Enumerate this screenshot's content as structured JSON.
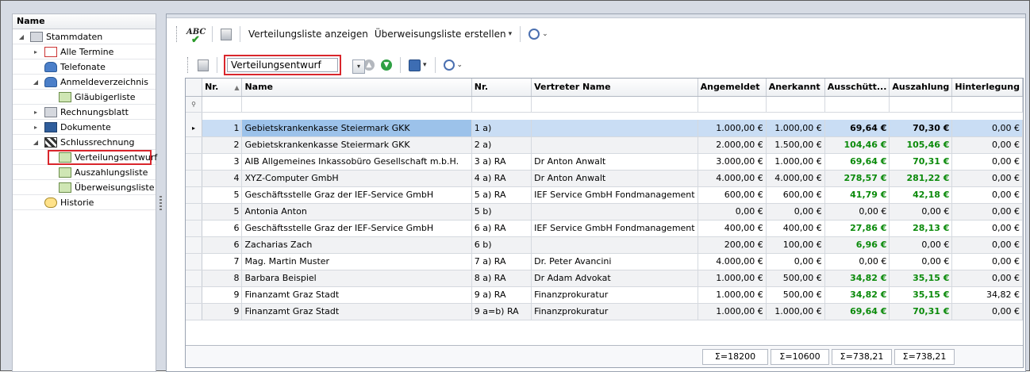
{
  "tree": {
    "header": "Name",
    "items": [
      {
        "label": "Stammdaten",
        "level": 0,
        "expander": "◢",
        "icon": "building-icon"
      },
      {
        "label": "Alle Termine",
        "level": 1,
        "expander": "▸",
        "icon": "calendar-icon"
      },
      {
        "label": "Telefonate",
        "level": 1,
        "expander": "",
        "icon": "phone-contacts-icon"
      },
      {
        "label": "Anmeldeverzeichnis",
        "level": 1,
        "expander": "◢",
        "icon": "users-icon"
      },
      {
        "label": "Gläubigerliste",
        "level": 2,
        "expander": "",
        "icon": "money-icon"
      },
      {
        "label": "Rechnungsblatt",
        "level": 1,
        "expander": "▸",
        "icon": "calculator-icon"
      },
      {
        "label": "Dokumente",
        "level": 1,
        "expander": "▸",
        "icon": "documents-icon"
      },
      {
        "label": "Schlussrechnung",
        "level": 1,
        "expander": "◢",
        "icon": "checkered-flag-icon"
      },
      {
        "label": "Verteilungsentwurf",
        "level": 2,
        "expander": "",
        "icon": "banknote-icon",
        "selected": true
      },
      {
        "label": "Auszahlungsliste",
        "level": 2,
        "expander": "",
        "icon": "banknote-icon"
      },
      {
        "label": "Überweisungsliste",
        "level": 2,
        "expander": "",
        "icon": "banknote-icon"
      },
      {
        "label": "Historie",
        "level": 1,
        "expander": "",
        "icon": "history-icon"
      }
    ]
  },
  "toolbar1": {
    "spellcheck_label": "ABC",
    "show_list_label": "Verteilungsliste anzeigen",
    "create_transfer_label": "Überweisungsliste erstellen",
    "dropdown_glyph": "▾",
    "chevron_glyph": "⌄"
  },
  "toolbar2": {
    "combo_value": "Verteilungsentwurf",
    "combo_arrow": "▾"
  },
  "grid": {
    "columns": [
      "Nr.",
      "Name",
      "Nr.",
      "Vertreter Name",
      "Angemeldet",
      "Anerkannt",
      "Ausschütt...",
      "Auszahlung",
      "Hinterlegung"
    ],
    "filter_glyph": "⚲",
    "row_indicator": "▸",
    "sort_glyph": "▲",
    "rows": [
      {
        "nr": "1",
        "name": "Gebietskrankenkasse Steiermark GKK",
        "nr2": "1 a)",
        "vertreter": "",
        "angemeldet": "1.000,00 €",
        "anerkannt": "1.000,00 €",
        "ausschuett": "69,64 €",
        "auszahlung": "70,30 €",
        "hinterlegung": "0,00 €"
      },
      {
        "nr": "2",
        "name": "Gebietskrankenkasse Steiermark GKK",
        "nr2": "2 a)",
        "vertreter": "",
        "angemeldet": "2.000,00 €",
        "anerkannt": "1.500,00 €",
        "ausschuett": "104,46 €",
        "auszahlung": "105,46 €",
        "hinterlegung": "0,00 €"
      },
      {
        "nr": "3",
        "name": "AIB Allgemeines Inkassobüro Gesellschaft m.b.H.",
        "nr2": "3 a) RA",
        "vertreter": "Dr Anton Anwalt",
        "angemeldet": "3.000,00 €",
        "anerkannt": "1.000,00 €",
        "ausschuett": "69,64 €",
        "auszahlung": "70,31 €",
        "hinterlegung": "0,00 €"
      },
      {
        "nr": "4",
        "name": "XYZ-Computer GmbH",
        "nr2": "4 a) RA",
        "vertreter": "Dr Anton Anwalt",
        "angemeldet": "4.000,00 €",
        "anerkannt": "4.000,00 €",
        "ausschuett": "278,57 €",
        "auszahlung": "281,22 €",
        "hinterlegung": "0,00 €"
      },
      {
        "nr": "5",
        "name": "Geschäftsstelle Graz der IEF-Service GmbH",
        "nr2": "5 a) RA",
        "vertreter": "IEF Service GmbH Fondmanagement",
        "angemeldet": "600,00 €",
        "anerkannt": "600,00 €",
        "ausschuett": "41,79 €",
        "auszahlung": "42,18 €",
        "hinterlegung": "0,00 €"
      },
      {
        "nr": "5",
        "name": "Antonia Anton",
        "nr2": "5 b)",
        "vertreter": "",
        "angemeldet": "0,00 €",
        "anerkannt": "0,00 €",
        "ausschuett": "0,00 €",
        "auszahlung": "0,00 €",
        "hinterlegung": "0,00 €"
      },
      {
        "nr": "6",
        "name": "Geschäftsstelle Graz der IEF-Service GmbH",
        "nr2": "6 a) RA",
        "vertreter": "IEF Service GmbH Fondmanagement",
        "angemeldet": "400,00 €",
        "anerkannt": "400,00 €",
        "ausschuett": "27,86 €",
        "auszahlung": "28,13 €",
        "hinterlegung": "0,00 €"
      },
      {
        "nr": "6",
        "name": "Zacharias Zach",
        "nr2": "6 b)",
        "vertreter": "",
        "angemeldet": "200,00 €",
        "anerkannt": "100,00 €",
        "ausschuett": "6,96 €",
        "auszahlung": "0,00 €",
        "hinterlegung": "0,00 €"
      },
      {
        "nr": "7",
        "name": "Mag. Martin Muster",
        "nr2": "7 a) RA",
        "vertreter": "Dr. Peter Avancini",
        "angemeldet": "4.000,00 €",
        "anerkannt": "0,00 €",
        "ausschuett": "0,00 €",
        "auszahlung": "0,00 €",
        "hinterlegung": "0,00 €"
      },
      {
        "nr": "8",
        "name": "Barbara Beispiel",
        "nr2": "8 a) RA",
        "vertreter": "Dr Adam Advokat",
        "angemeldet": "1.000,00 €",
        "anerkannt": "500,00 €",
        "ausschuett": "34,82 €",
        "auszahlung": "35,15 €",
        "hinterlegung": "0,00 €"
      },
      {
        "nr": "9",
        "name": "Finanzamt Graz Stadt",
        "nr2": "9 a) RA",
        "vertreter": "Finanzprokuratur",
        "angemeldet": "1.000,00 €",
        "anerkannt": "500,00 €",
        "ausschuett": "34,82 €",
        "auszahlung": "35,15 €",
        "hinterlegung": "34,82 €"
      },
      {
        "nr": "9",
        "name": "Finanzamt Graz Stadt",
        "nr2": "9 a=b) RA",
        "vertreter": "Finanzprokuratur",
        "angemeldet": "1.000,00 €",
        "anerkannt": "1.000,00 €",
        "ausschuett": "69,64 €",
        "auszahlung": "70,31 €",
        "hinterlegung": "0,00 €"
      }
    ],
    "totals": {
      "angemeldet": "Σ=18200",
      "anerkannt": "Σ=10600",
      "ausschuett": "Σ=738,21",
      "auszahlung": "Σ=738,21"
    }
  },
  "colors": {
    "accent_green": "#0a8a0a",
    "selection": "#c9ddf4",
    "highlight_red": "#d9262c"
  }
}
